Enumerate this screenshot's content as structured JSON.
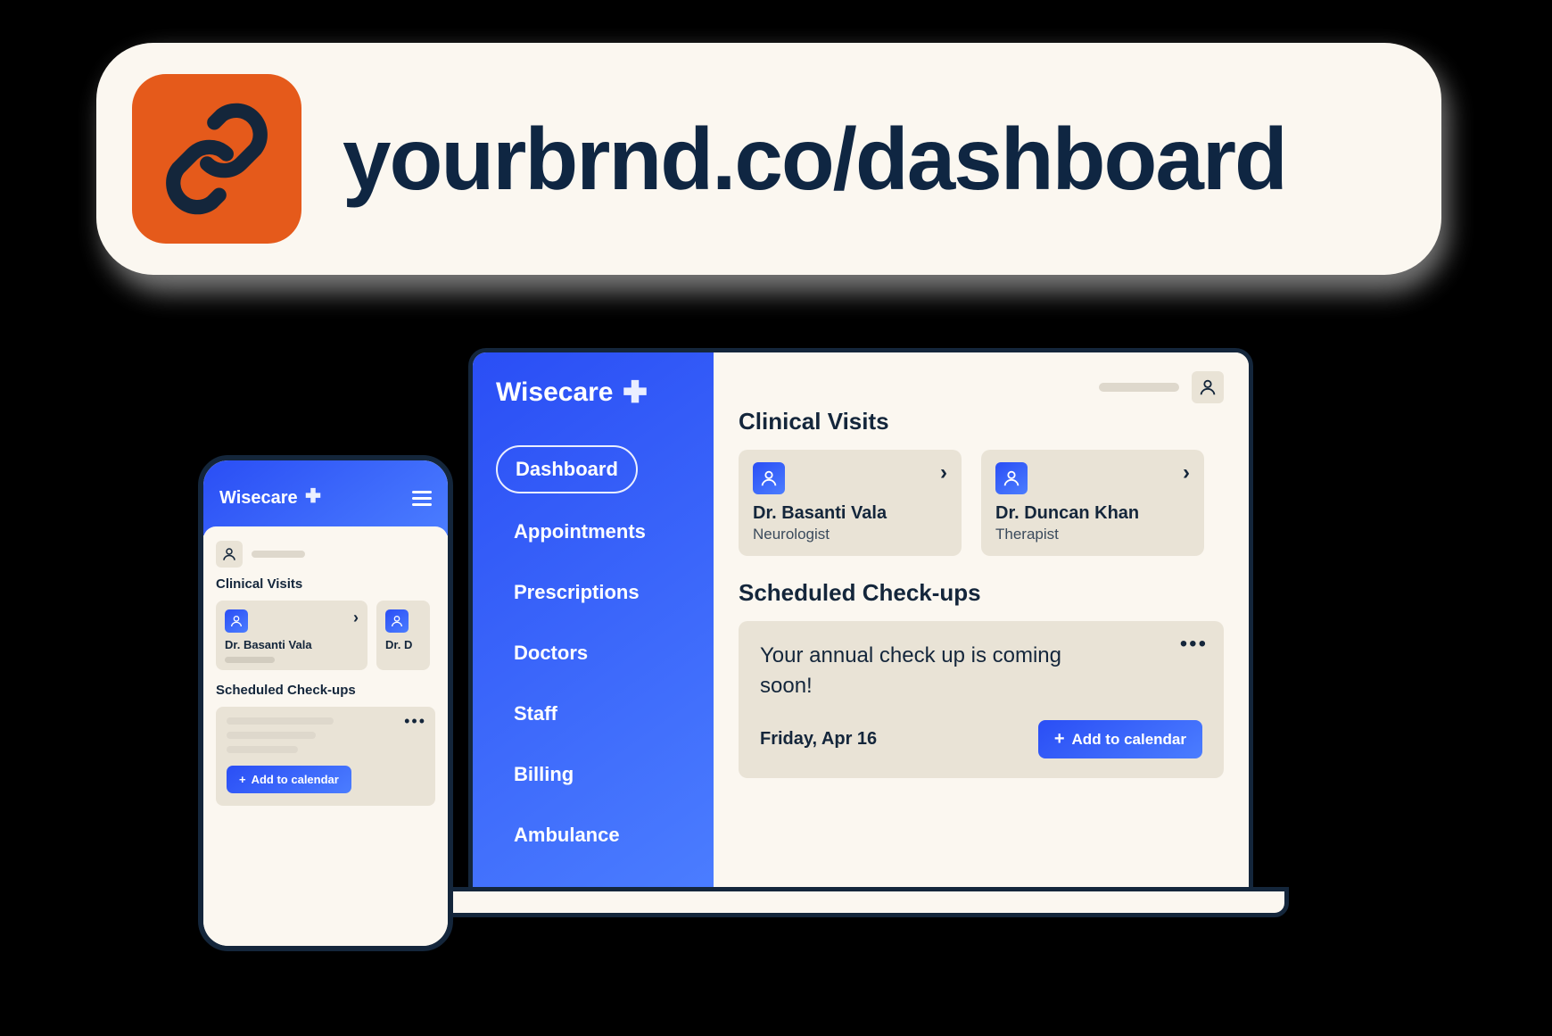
{
  "url_pill": {
    "url": "yourbrnd.co/dashboard"
  },
  "brand": {
    "name": "Wisecare"
  },
  "sidebar": {
    "items": [
      {
        "label": "Dashboard",
        "active": true
      },
      {
        "label": "Appointments"
      },
      {
        "label": "Prescriptions"
      },
      {
        "label": "Doctors"
      },
      {
        "label": "Staff"
      },
      {
        "label": "Billing"
      },
      {
        "label": "Ambulance"
      }
    ]
  },
  "desktop": {
    "section_visits": "Clinical Visits",
    "visits": [
      {
        "name": "Dr. Basanti Vala",
        "role": "Neurologist"
      },
      {
        "name": "Dr. Duncan Khan",
        "role": "Therapist"
      }
    ],
    "section_checkups": "Scheduled Check-ups",
    "checkup": {
      "message": "Your annual check up is coming soon!",
      "date": "Friday, Apr 16",
      "cta": "Add to calendar"
    }
  },
  "mobile": {
    "section_visits": "Clinical Visits",
    "visits": [
      {
        "name": "Dr. Basanti Vala"
      },
      {
        "name": "Dr. D"
      }
    ],
    "section_checkups": "Scheduled Check-ups",
    "cta": "Add to calendar"
  },
  "colors": {
    "accent_grad_from": "#2a4ef5",
    "accent_grad_to": "#4b7dff",
    "badge_orange": "#e55a1b",
    "ink": "#14263b",
    "cream": "#fbf7f0",
    "card": "#e9e3d6"
  }
}
